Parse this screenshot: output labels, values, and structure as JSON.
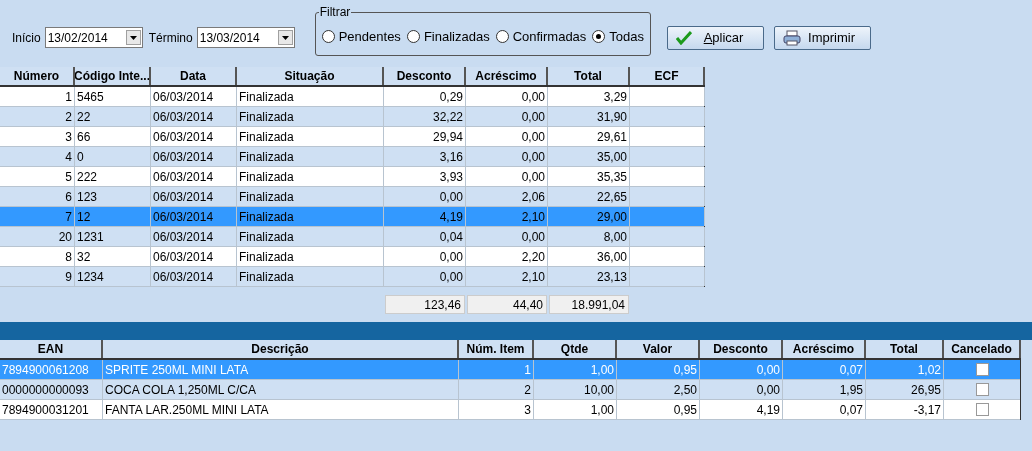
{
  "period": {
    "start": {
      "label": "Início",
      "value": "13/02/2014"
    },
    "end": {
      "label": "Término",
      "value": "13/03/2014"
    }
  },
  "filter": {
    "title": "Filtrar",
    "options": [
      {
        "label": "Pendentes",
        "selected": false
      },
      {
        "label": "Finalizadas",
        "selected": false
      },
      {
        "label": "Confirmadas",
        "selected": false
      },
      {
        "label": "Todas",
        "selected": true
      }
    ]
  },
  "buttons": [
    {
      "kind": "apply",
      "label": "Aplicar"
    },
    {
      "kind": "print",
      "label": "Imprimir"
    }
  ],
  "orders": {
    "columns": [
      "Número",
      "Código Inte...",
      "Data",
      "Situação",
      "Desconto",
      "Acréscimo",
      "Total",
      "ECF"
    ],
    "rows": [
      {
        "selected": false,
        "cells": [
          "1",
          "5465",
          "06/03/2014",
          "Finalizada",
          "0,29",
          "0,00",
          "3,29",
          ""
        ]
      },
      {
        "selected": false,
        "cells": [
          "2",
          "22",
          "06/03/2014",
          "Finalizada",
          "32,22",
          "0,00",
          "31,90",
          ""
        ]
      },
      {
        "selected": false,
        "cells": [
          "3",
          "66",
          "06/03/2014",
          "Finalizada",
          "29,94",
          "0,00",
          "29,61",
          ""
        ]
      },
      {
        "selected": false,
        "cells": [
          "4",
          "0",
          "06/03/2014",
          "Finalizada",
          "3,16",
          "0,00",
          "35,00",
          ""
        ]
      },
      {
        "selected": false,
        "cells": [
          "5",
          "222",
          "06/03/2014",
          "Finalizada",
          "3,93",
          "0,00",
          "35,35",
          ""
        ]
      },
      {
        "selected": false,
        "cells": [
          "6",
          "123",
          "06/03/2014",
          "Finalizada",
          "0,00",
          "2,06",
          "22,65",
          ""
        ]
      },
      {
        "selected": true,
        "cells": [
          "7",
          "12",
          "06/03/2014",
          "Finalizada",
          "4,19",
          "2,10",
          "29,00",
          ""
        ]
      },
      {
        "selected": false,
        "cells": [
          "20",
          "1231",
          "06/03/2014",
          "Finalizada",
          "0,04",
          "0,00",
          "8,00",
          ""
        ]
      },
      {
        "selected": false,
        "cells": [
          "8",
          "32",
          "06/03/2014",
          "Finalizada",
          "0,00",
          "2,20",
          "36,00",
          ""
        ]
      },
      {
        "selected": false,
        "cells": [
          "9",
          "1234",
          "06/03/2014",
          "Finalizada",
          "0,00",
          "2,10",
          "23,13",
          ""
        ]
      }
    ],
    "totals": [
      "123,46",
      "44,40",
      "18.991,04"
    ]
  },
  "items": {
    "columns": [
      "EAN",
      "Descrição",
      "Núm. Item",
      "Qtde",
      "Valor",
      "Desconto",
      "Acréscimo",
      "Total",
      "Cancelado"
    ],
    "rows": [
      {
        "selected": true,
        "cancelled": false,
        "cells": [
          "7894900061208",
          "SPRITE 250ML MINI LATA",
          "1",
          "1,00",
          "0,95",
          "0,00",
          "0,07",
          "1,02"
        ]
      },
      {
        "selected": false,
        "cancelled": false,
        "cells": [
          "0000000000093",
          "COCA COLA 1,250ML C/CA",
          "2",
          "10,00",
          "2,50",
          "0,00",
          "1,95",
          "26,95"
        ]
      },
      {
        "selected": false,
        "cancelled": false,
        "cells": [
          "7894900031201",
          "FANTA LAR.250ML MINI LATA",
          "3",
          "1,00",
          "0,95",
          "4,19",
          "0,07",
          "-3,17"
        ]
      }
    ]
  }
}
